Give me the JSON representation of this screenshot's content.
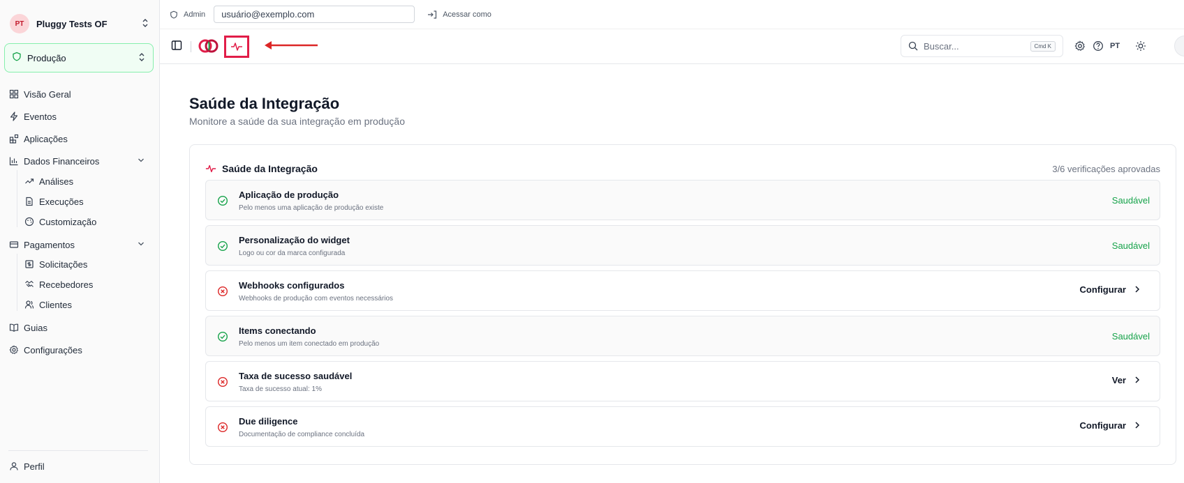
{
  "sidebar": {
    "org": {
      "initials": "PT",
      "name": "Pluggy Tests OF"
    },
    "environment": {
      "label": "Produção"
    },
    "items": [
      {
        "label": "Visão Geral"
      },
      {
        "label": "Eventos"
      },
      {
        "label": "Aplicações"
      },
      {
        "label": "Dados Financeiros"
      },
      {
        "label": "Análises"
      },
      {
        "label": "Execuções"
      },
      {
        "label": "Customização"
      },
      {
        "label": "Pagamentos"
      },
      {
        "label": "Solicitações"
      },
      {
        "label": "Recebedores"
      },
      {
        "label": "Clientes"
      },
      {
        "label": "Guias"
      },
      {
        "label": "Configurações"
      }
    ],
    "profile": {
      "label": "Perfil"
    }
  },
  "topbar": {
    "admin_label": "Admin",
    "impersonate_value": "usuário@exemplo.com",
    "access_label": "Acessar como"
  },
  "toolbar": {
    "search_placeholder": "Buscar...",
    "search_shortcut": "Cmd K",
    "language": "PT"
  },
  "page": {
    "title": "Saúde da Integração",
    "subtitle": "Monitore a saúde da sua integração em produção"
  },
  "health_card": {
    "title": "Saúde da Integração",
    "summary": "3/6 verificações aprovadas",
    "checks": [
      {
        "title": "Aplicação de produção",
        "description": "Pelo menos uma aplicação de produção existe",
        "status": "Saudável"
      },
      {
        "title": "Personalização do widget",
        "description": "Logo ou cor da marca configurada",
        "status": "Saudável"
      },
      {
        "title": "Webhooks configurados",
        "description": "Webhooks de produção com eventos necessários",
        "action": "Configurar"
      },
      {
        "title": "Items conectando",
        "description": "Pelo menos um item conectado em produção",
        "status": "Saudável"
      },
      {
        "title": "Taxa de sucesso saudável",
        "description": "Taxa de sucesso atual: 1%",
        "action": "Ver"
      },
      {
        "title": "Due diligence",
        "description": "Documentação de compliance concluída",
        "action": "Configurar"
      }
    ]
  },
  "colors": {
    "brand": "#e11d48",
    "success": "#16a34a",
    "env_border": "#86efac"
  }
}
